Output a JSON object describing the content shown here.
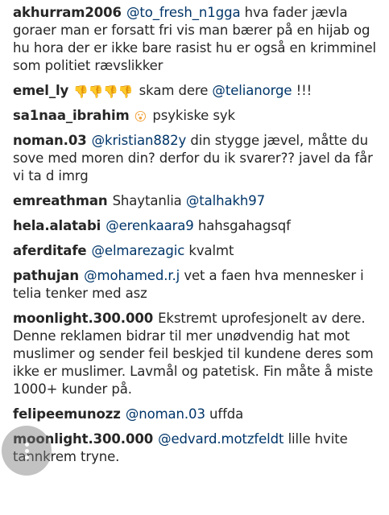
{
  "comments": [
    {
      "user": "akhurram2006",
      "mention": "@to_fresh_n1gga",
      "text": "hva fader jævla goraer man er forsatt fri vis man bærer på en hijab og hu hora der er ikke bare rasist hu er også en krimminel som politiet rævslikker"
    },
    {
      "user": "emel_ly",
      "emoji": "👎👎👎👎",
      "text_before": "skam dere",
      "mention": "@telianorge",
      "text": "!!!"
    },
    {
      "user": "sa1naa_ibrahim",
      "emoji": "😮",
      "text": "psykiske syk"
    },
    {
      "user": "noman.03",
      "mention": "@kristian882y",
      "text": "din stygge jævel, måtte du sove med moren din? derfor du ik svarer?? javel da får vi ta d imrg"
    },
    {
      "user": "emreathman",
      "text_before": "Shaytanlia",
      "mention": "@talhakh97"
    },
    {
      "user": "hela.alatabi",
      "mention": "@erenkaara9",
      "text": "hahsgahagsqf"
    },
    {
      "user": "aferditafe",
      "mention": "@elmarezagic",
      "text": "kvalmt"
    },
    {
      "user": "pathujan",
      "mention": "@mohamed.r.j",
      "text": "vet a faen hva mennesker i telia tenker med asz"
    },
    {
      "user": "moonlight.300.000",
      "text": "Ekstremt uprofesjonelt av dere. Denne reklamen bidrar til mer unødvendig hat mot muslimer og sender feil beskjed til kundene deres som ikke er muslimer. Lavmål og patetisk. Fin måte å miste 1000+ kunder på."
    },
    {
      "user": "felipeemunozz",
      "mention": "@noman.03",
      "text": "uffda"
    },
    {
      "user": "moonlight.300.000",
      "mention": "@edvard.motzfeldt",
      "text": "lille hvite tannkrem tryne."
    }
  ],
  "colors": {
    "text": "#262626",
    "mention": "#003569",
    "background": "#ffffff"
  },
  "icons": {
    "fab": "more-vertical-icon"
  }
}
